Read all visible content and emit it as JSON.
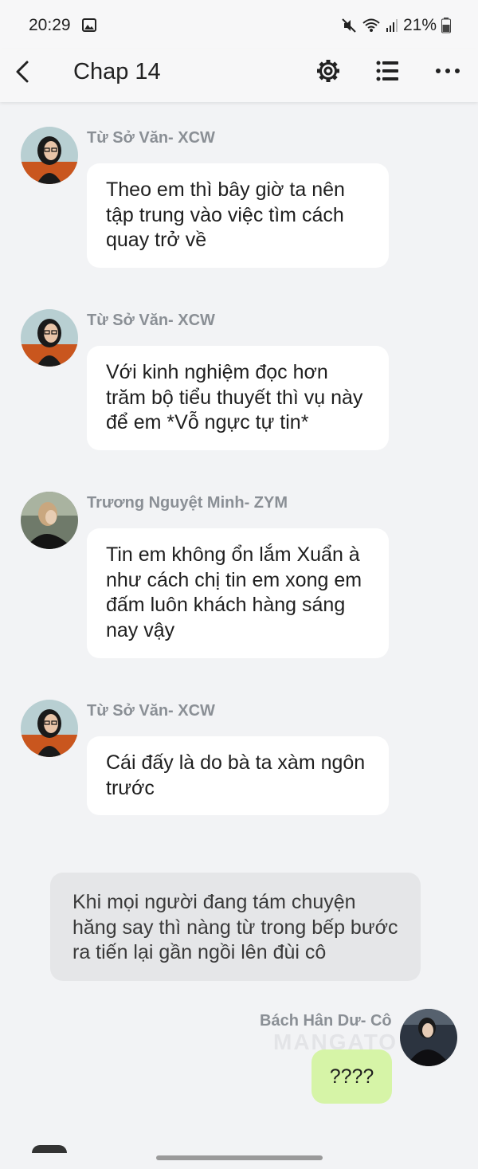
{
  "status_bar": {
    "time": "20:29",
    "battery": "21%",
    "icons": [
      "gallery-icon",
      "mute-icon",
      "wifi-icon",
      "signal-icon",
      "battery-icon"
    ]
  },
  "app_bar": {
    "title": "Chap 14",
    "icons": [
      "back-arrow-icon",
      "gear-icon",
      "list-icon",
      "more-dots-icon"
    ]
  },
  "messages": [
    {
      "sender": "Từ Sở Văn- XCW",
      "text": "Theo em thì bây giờ ta nên tập trung vào việc tìm cách quay trở về"
    },
    {
      "sender": "Từ Sở Văn- XCW",
      "text": "Với kinh nghiệm đọc hơn trăm bộ tiểu thuyết thì vụ này để em *Vỗ ngực tự tin*"
    },
    {
      "sender": "Trương Nguyệt Minh- ZYM",
      "text": "Tin em không ổn lắm Xuẩn à như cách chị tin em xong em đấm luôn khách hàng sáng nay vậy"
    },
    {
      "sender": "Từ Sở Văn- XCW",
      "text": "Cái đấy là do bà ta xàm ngôn trước"
    }
  ],
  "narration": "Khi mọi người đang tám chuyện hăng say thì nàng từ trong bếp bước ra tiến lại gần ngồi lên đùi cô",
  "own_message": {
    "sender": "Bách Hân Dư- Cô",
    "text": "????"
  },
  "watermark": "MANGATO",
  "colors": {
    "background": "#f2f3f5",
    "bubble": "#ffffff",
    "own_bubble": "#d6f4a7",
    "narration_bubble": "#e5e6e8",
    "sender_name": "#8a8f95"
  }
}
